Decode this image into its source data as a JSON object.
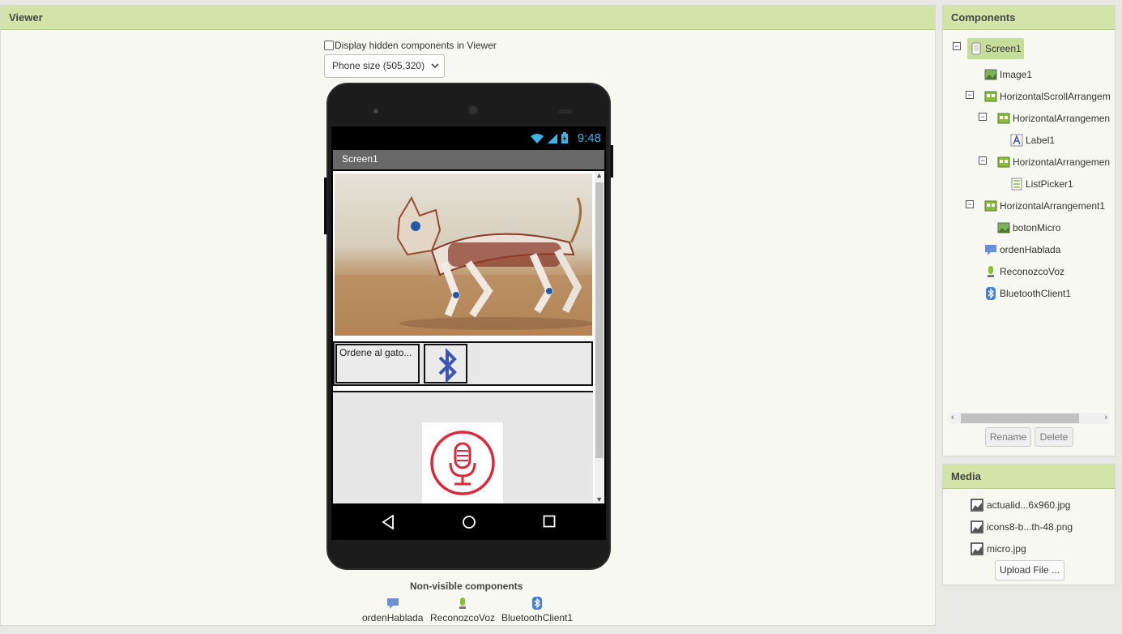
{
  "viewer": {
    "title": "Viewer",
    "hidden_checkbox_label": "Display hidden components in Viewer",
    "hidden_checkbox_checked": false,
    "size_select": "Phone size (505,320)",
    "phone": {
      "status_time": "9:48",
      "screen_title": "Screen1",
      "label_text": "Ordene al gato..."
    },
    "nonvisible_title": "Non-visible components",
    "nonvisible": [
      "ordenHablada",
      "ReconozcoVoz",
      "BluetoothClient1"
    ]
  },
  "components": {
    "title": "Components",
    "tree": [
      {
        "label": "Screen1",
        "icon": "screen-icon",
        "selected": true
      },
      {
        "label": "Image1",
        "icon": "image-icon"
      },
      {
        "label": "HorizontalScrollArrangem",
        "icon": "arrangement-icon"
      },
      {
        "label": "HorizontalArrangemen",
        "icon": "arrangement-icon"
      },
      {
        "label": "Label1",
        "icon": "label-icon"
      },
      {
        "label": "HorizontalArrangemen",
        "icon": "arrangement-icon"
      },
      {
        "label": "ListPicker1",
        "icon": "listpicker-icon"
      },
      {
        "label": "HorizontalArrangement1",
        "icon": "arrangement-icon"
      },
      {
        "label": "botonMicro",
        "icon": "image-icon"
      },
      {
        "label": "ordenHablada",
        "icon": "speech-icon"
      },
      {
        "label": "ReconozcoVoz",
        "icon": "microphone-icon"
      },
      {
        "label": "BluetoothClient1",
        "icon": "bluetooth-icon"
      }
    ],
    "rename_label": "Rename",
    "delete_label": "Delete"
  },
  "media": {
    "title": "Media",
    "files": [
      "actualid...6x960.jpg",
      "icons8-b...th-48.png",
      "micro.jpg"
    ],
    "upload_label": "Upload File ..."
  },
  "colors": {
    "header_bg": "#d3e4a8",
    "selected_bg": "#c7dd9b",
    "status_accent": "#3cb4e8",
    "bluetooth_blue": "#3a55b5",
    "mic_red": "#e0263a"
  }
}
